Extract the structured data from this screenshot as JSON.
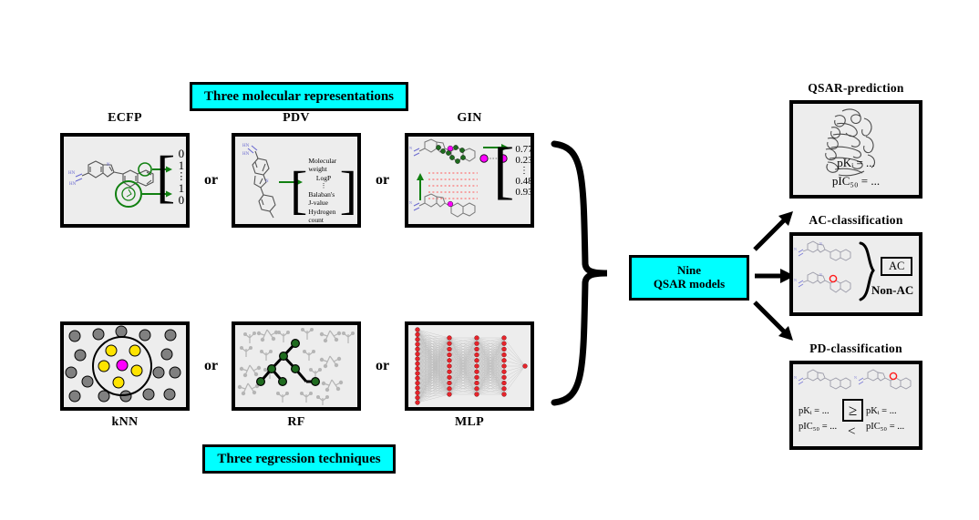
{
  "figure": {
    "top_banner": "Three molecular representations",
    "bottom_banner": "Three regression techniques",
    "center_box_line1": "Nine",
    "center_box_line2": "QSAR models",
    "or_label": "or",
    "colors": {
      "banner_fill": "#00ffff",
      "panel_fill": "#ededed",
      "outline": "#000000",
      "arrow_green": "#118011",
      "node_green": "#1f6b1f",
      "node_magenta": "#ff00ff",
      "node_yellow": "#ffe400",
      "node_gray": "#808080",
      "node_red": "#e8232a",
      "bond_blue": "#6a6ad0",
      "dashed_red": "#ff5a5a",
      "highlight_red": "#ff1a1a"
    }
  },
  "representations": [
    {
      "id": "ecfp",
      "label": "ECFP",
      "vector": [
        "0",
        "1",
        "⋮",
        "1",
        "0"
      ]
    },
    {
      "id": "pdv",
      "label": "PDV",
      "vector": [
        "Molecular weight",
        "LogP",
        "⋮",
        "Balaban's J-value",
        "Hydrogen count"
      ]
    },
    {
      "id": "gin",
      "label": "GIN",
      "vector": [
        "0.77",
        "0.23",
        "⋮",
        "0.48",
        "0.93"
      ]
    }
  ],
  "regressors": [
    {
      "id": "knn",
      "label": "kNN"
    },
    {
      "id": "rf",
      "label": "RF"
    },
    {
      "id": "mlp",
      "label": "MLP"
    }
  ],
  "tasks": [
    {
      "id": "qsar-prediction",
      "label": "QSAR-prediction",
      "lines": [
        "pKᵢ = ...",
        "pIC₅₀ = ..."
      ]
    },
    {
      "id": "ac-classification",
      "label": "AC-classification",
      "boxed_class": "AC",
      "other_class": "Non-AC"
    },
    {
      "id": "pd-classification",
      "label": "PD-classification",
      "left_lines": [
        "pKᵢ = ...",
        "pIC₅₀ = ..."
      ],
      "right_lines": [
        "pKᵢ = ...",
        "pIC₅₀ = ..."
      ],
      "boxed_operator": "≥",
      "operator": "<"
    }
  ]
}
